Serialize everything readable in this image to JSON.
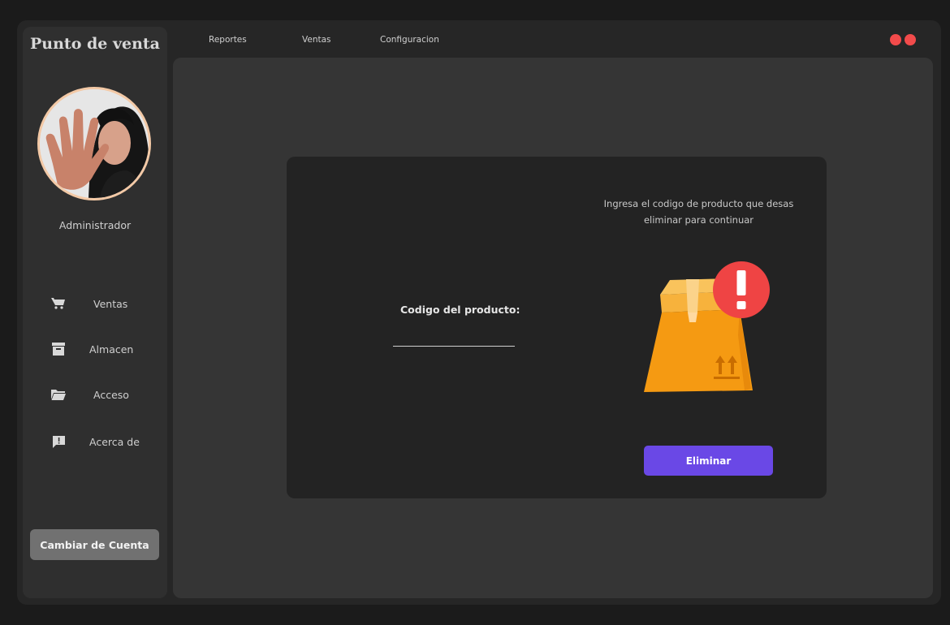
{
  "app": {
    "title": "Punto de venta"
  },
  "user": {
    "name": "Administrador"
  },
  "sidebar": {
    "items": [
      {
        "label": "Ventas",
        "icon": "cart-icon"
      },
      {
        "label": "Almacen",
        "icon": "archive-icon"
      },
      {
        "label": "Acceso",
        "icon": "folder-icon"
      },
      {
        "label": "Acerca de",
        "icon": "feedback-icon"
      }
    ],
    "switch_account_label": "Cambiar de Cuenta"
  },
  "topnav": {
    "items": [
      "Reportes",
      "Ventas",
      "Configuracion"
    ]
  },
  "form": {
    "instructions": "Ingresa el codigo de producto que desas eliminar para continuar",
    "field_label": "Codigo del producto:",
    "field_value": "",
    "submit_label": "Eliminar"
  },
  "illustration": {
    "icon": "box-warning-icon",
    "badge_text": "!"
  },
  "colors": {
    "accent": "#6a48e6",
    "window_dots": "#f24b4b",
    "box": "#f59a12",
    "warning": "#ef4444"
  }
}
